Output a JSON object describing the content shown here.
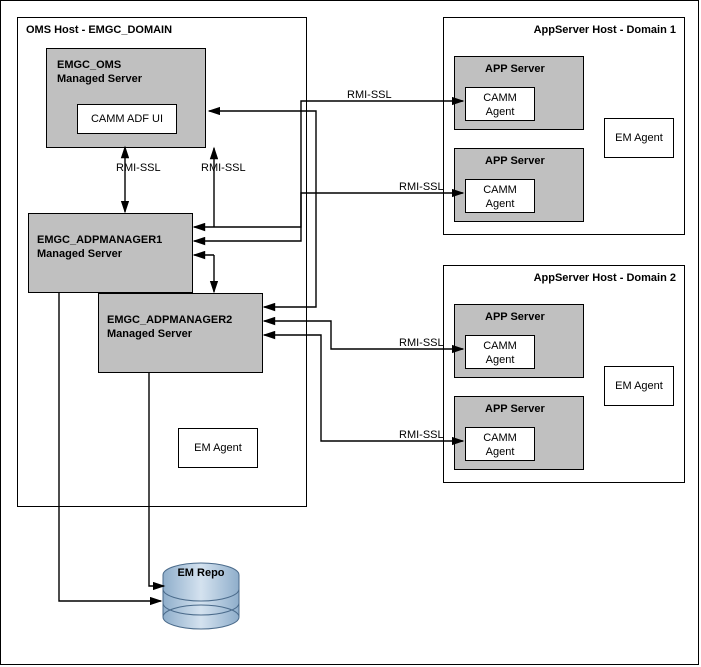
{
  "oms": {
    "title": "OMS Host - EMGC_DOMAIN",
    "emgc_oms": {
      "title": "EMGC_OMS",
      "subtitle": "Managed Server",
      "camm_adf": "CAMM ADF UI"
    },
    "adp1": {
      "title": "EMGC_ADPMANAGER1",
      "subtitle": "Managed Server"
    },
    "adp2": {
      "title": "EMGC_ADPMANAGER2",
      "subtitle": "Managed Server"
    },
    "em_agent": "EM Agent"
  },
  "domain1": {
    "title": "AppServer Host - Domain 1",
    "app_server": "APP Server",
    "camm_agent_l1": "CAMM",
    "camm_agent_l2": "Agent",
    "em_agent": "EM Agent"
  },
  "domain2": {
    "title": "AppServer Host - Domain 2",
    "app_server": "APP Server",
    "camm_agent_l1": "CAMM",
    "camm_agent_l2": "Agent",
    "em_agent": "EM Agent"
  },
  "em_repo": "EM Repo",
  "link": {
    "rmi_ssl": "RMI-SSL"
  }
}
